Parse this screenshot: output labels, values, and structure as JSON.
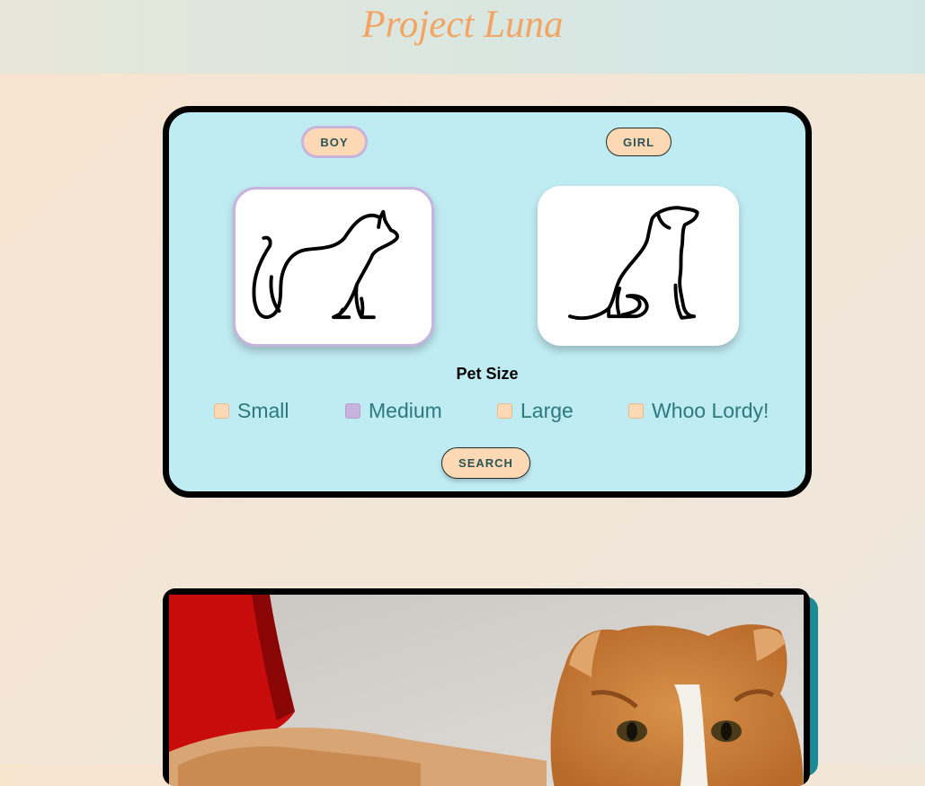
{
  "header": {
    "title": "Project Luna"
  },
  "filters": {
    "gender_boy": "BOY",
    "gender_girl": "GIRL",
    "size_heading": "Pet Size",
    "sizes": [
      {
        "label": "Small",
        "checked": false
      },
      {
        "label": "Medium",
        "checked": true
      },
      {
        "label": "Large",
        "checked": false
      },
      {
        "label": "Whoo Lordy!",
        "checked": false
      }
    ],
    "search_label": "SEARCH"
  },
  "pets": [
    {
      "icon": "cat-silhouette-icon",
      "selected": true
    },
    {
      "icon": "dog-silhouette-icon",
      "selected": false
    }
  ],
  "colors": {
    "accent_orange": "#f4a462",
    "button_peach": "#fcd9b4",
    "panel_blue": "#bfebf2",
    "selected_lavender": "#c8b3de",
    "text_teal": "#2b7a80"
  }
}
